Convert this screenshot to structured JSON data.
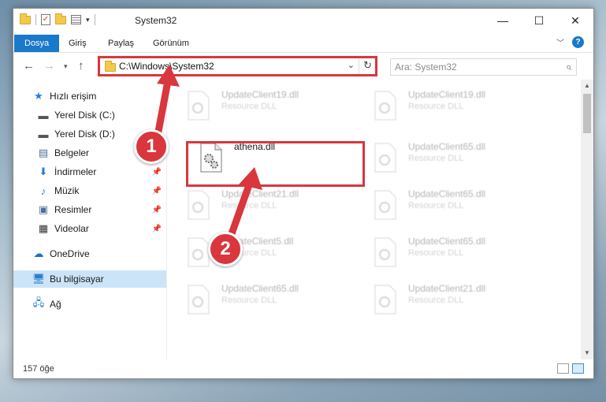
{
  "window": {
    "title": "System32",
    "controls": {
      "minimize": "—",
      "maximize": "☐",
      "close": "✕"
    }
  },
  "ribbon": {
    "tabs": [
      "Dosya",
      "Giriş",
      "Paylaş",
      "Görünüm"
    ],
    "help": "?"
  },
  "address_bar": {
    "path": "C:\\Windows\\System32",
    "search_placeholder": "Ara: System32"
  },
  "sidebar": {
    "items": [
      {
        "label": "Hızlı erişim",
        "icon": "star-icon"
      },
      {
        "label": "Yerel Disk (C:)",
        "icon": "drive-icon"
      },
      {
        "label": "Yerel Disk (D:)",
        "icon": "drive-icon"
      },
      {
        "label": "Belgeler",
        "icon": "documents-icon"
      },
      {
        "label": "İndirmeler",
        "icon": "download-icon"
      },
      {
        "label": "Müzik",
        "icon": "music-icon"
      },
      {
        "label": "Resimler",
        "icon": "pictures-icon"
      },
      {
        "label": "Videolar",
        "icon": "video-icon"
      },
      {
        "label": "OneDrive",
        "icon": "cloud-icon"
      },
      {
        "label": "Bu bilgisayar",
        "icon": "computer-icon"
      },
      {
        "label": "Ağ",
        "icon": "network-icon"
      }
    ]
  },
  "files": [
    {
      "name": "UpdateClient19.dll",
      "type": "Resource DLL"
    },
    {
      "name": "UpdateClient19.dll",
      "type": "Resource DLL"
    },
    {
      "name": "athena.dll",
      "type": ""
    },
    {
      "name": "UpdateClient65.dll",
      "type": "Resource DLL"
    },
    {
      "name": "UpdateClient21.dll",
      "type": "Resource DLL"
    },
    {
      "name": "UpdateClient65.dll",
      "type": "Resource DLL"
    },
    {
      "name": "UpdateClient5.dll",
      "type": "Resource DLL"
    },
    {
      "name": "UpdateClient65.dll",
      "type": "Resource DLL"
    },
    {
      "name": "UpdateClient65.dll",
      "type": "Resource DLL"
    },
    {
      "name": "UpdateClient21.dll",
      "type": "Resource DLL"
    }
  ],
  "status": {
    "count": "157 öğe"
  },
  "annotations": {
    "step1": "1",
    "step2": "2",
    "color": "#d9363e"
  }
}
